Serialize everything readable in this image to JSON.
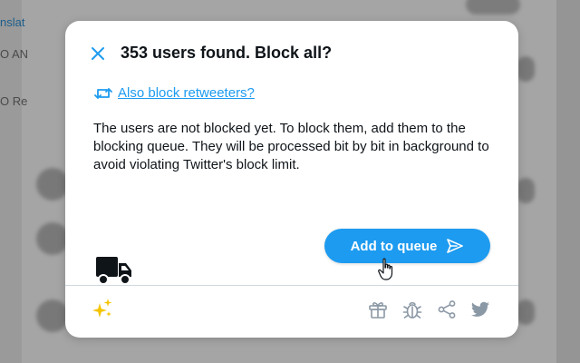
{
  "backdrop": {
    "fragments": [
      "nslat",
      "O AN",
      "O Re"
    ]
  },
  "dialog": {
    "title": "353 users found. Block all?",
    "retweet_link": "Also block retweeters?",
    "body": "The users are not blocked yet. To block them, add them to the blocking queue. They will be processed bit by bit in background to avoid violating Twitter's block limit.",
    "primary_button": "Add to queue"
  },
  "icons": {
    "close": "close-icon",
    "retweet": "retweet-icon",
    "truck": "truck-icon",
    "send": "send-icon",
    "sparkles": "sparkles-icon",
    "gift": "gift-icon",
    "bug": "bug-icon",
    "share": "share-icon",
    "twitter": "twitter-bird-icon",
    "cursor": "hand-pointer-cursor"
  },
  "colors": {
    "accent": "#1d9bf0",
    "text": "#0f1419",
    "footer_icon": "#8b98a5",
    "sparkles": "#f5c400"
  }
}
